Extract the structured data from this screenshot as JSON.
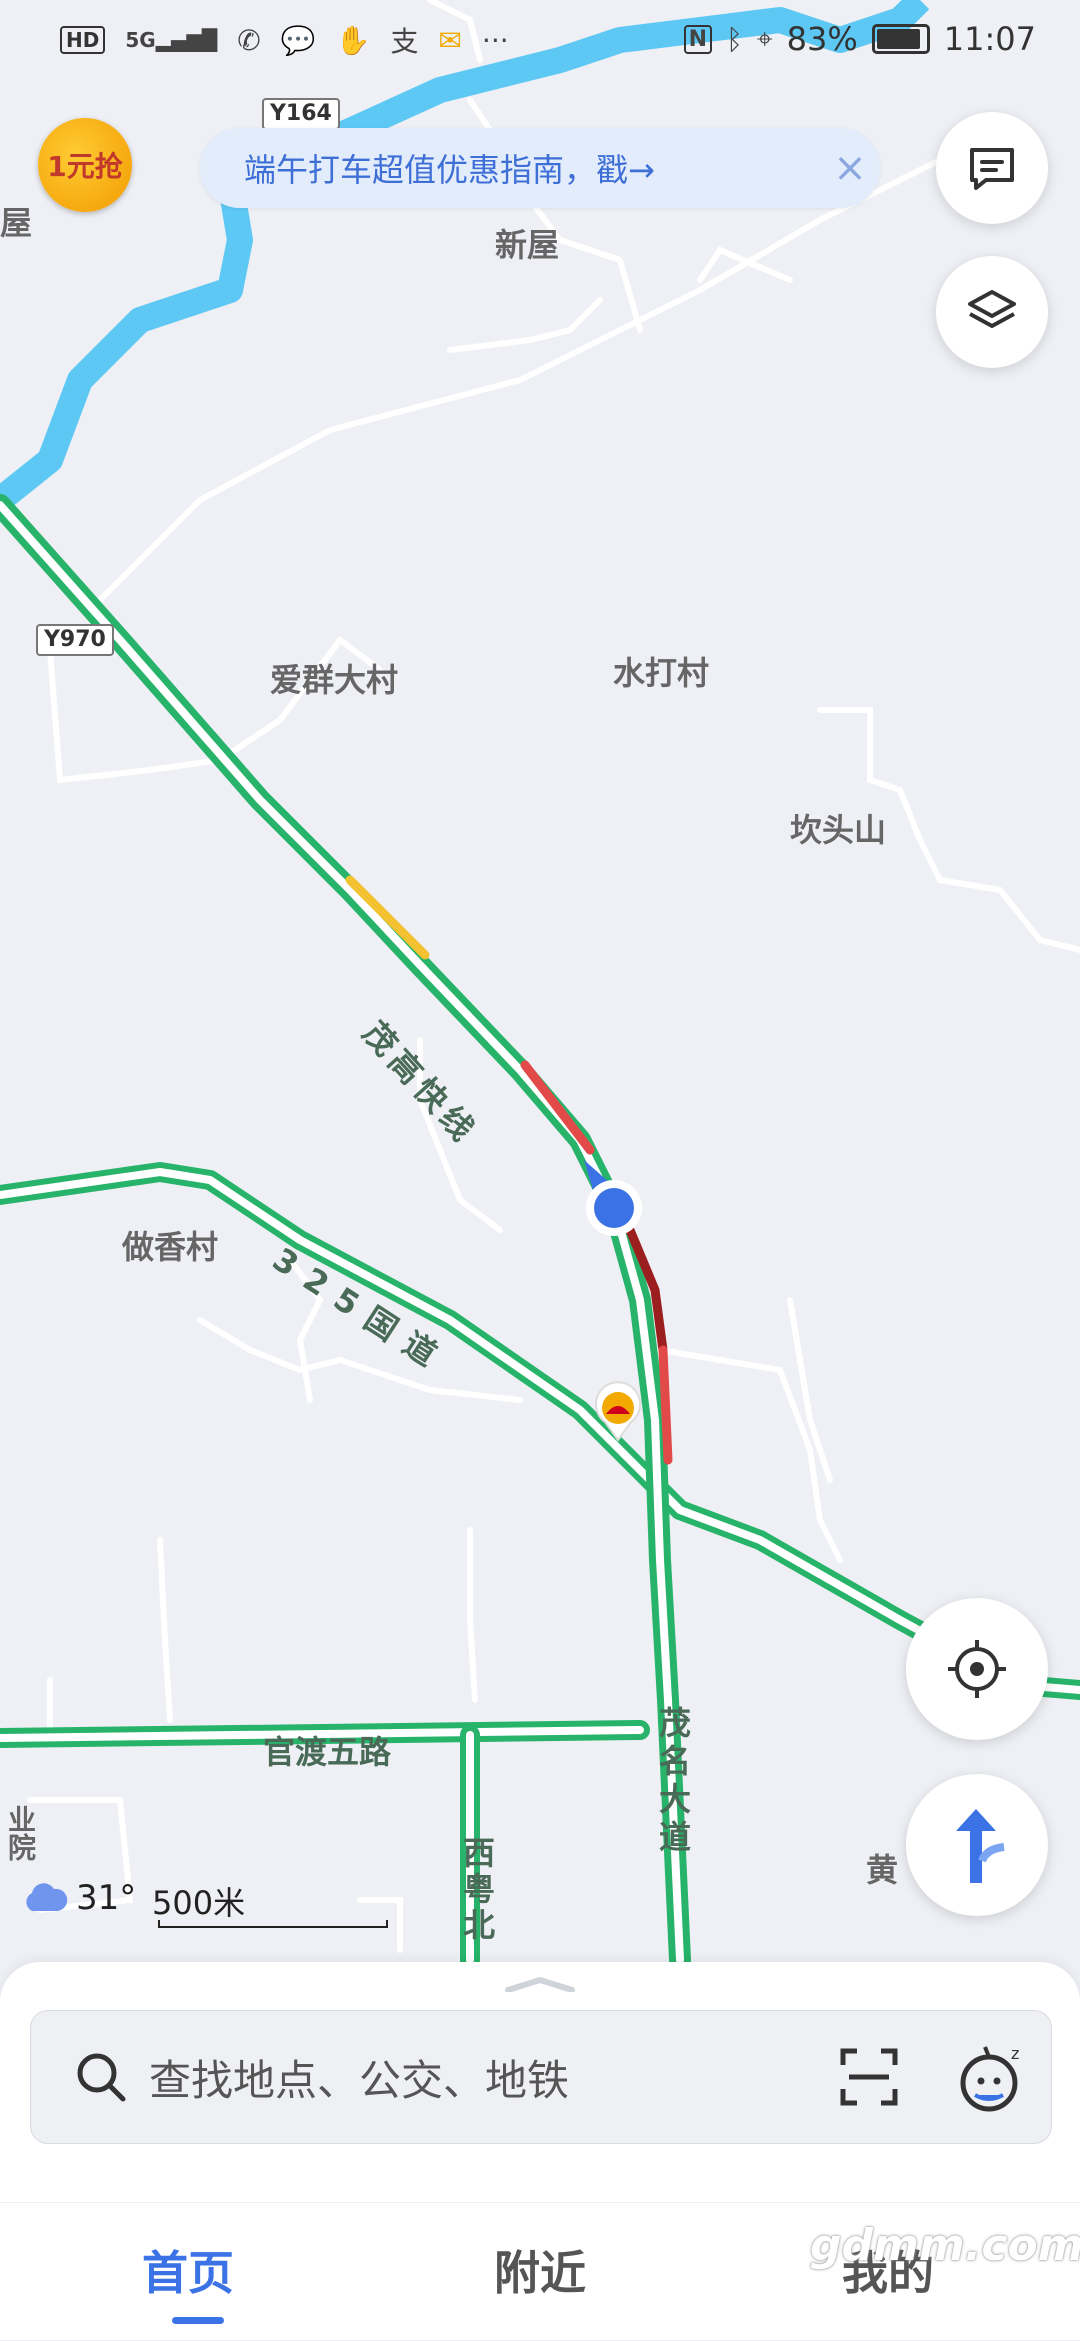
{
  "status_bar": {
    "left_icons": [
      "HD",
      "5G",
      "missed-call-icon",
      "chat-icon",
      "hand-icon",
      "alipay-icon",
      "mail-icon",
      "···"
    ],
    "nfc": "N",
    "battery": "83%",
    "time": "11:07"
  },
  "promo": {
    "badge": "1元抢"
  },
  "banner": {
    "text": "端午打车超值优惠指南，戳→"
  },
  "map": {
    "places": [
      "新屋",
      "爱群大村",
      "水打村",
      "坎头山",
      "做香村",
      "黄"
    ],
    "road_shields": [
      "Y164",
      "Y970"
    ],
    "roads": {
      "expressway": "茂高快线",
      "national": "325国道",
      "avenue": "茂名大道",
      "guandu": "官渡五路",
      "xiyue": "西粤北"
    },
    "edge_fragment_top": "屋",
    "edge_fragment_bottom": "业院"
  },
  "weather": {
    "temp": "31°",
    "icon": "cloud-icon"
  },
  "scale": {
    "label": "500米"
  },
  "search": {
    "placeholder": "查找地点、公交、地铁"
  },
  "tabs": [
    {
      "label": "首页",
      "active": true
    },
    {
      "label": "附近",
      "active": false
    },
    {
      "label": "我的",
      "active": false
    }
  ],
  "watermark": "gdmm.com",
  "colors": {
    "accent": "#3b73e6",
    "road_green": "#27b46a",
    "traffic_yellow": "#f2c230",
    "traffic_red": "#e24a4a",
    "traffic_darkred": "#9c1f1f",
    "river": "#5ec8f5"
  }
}
